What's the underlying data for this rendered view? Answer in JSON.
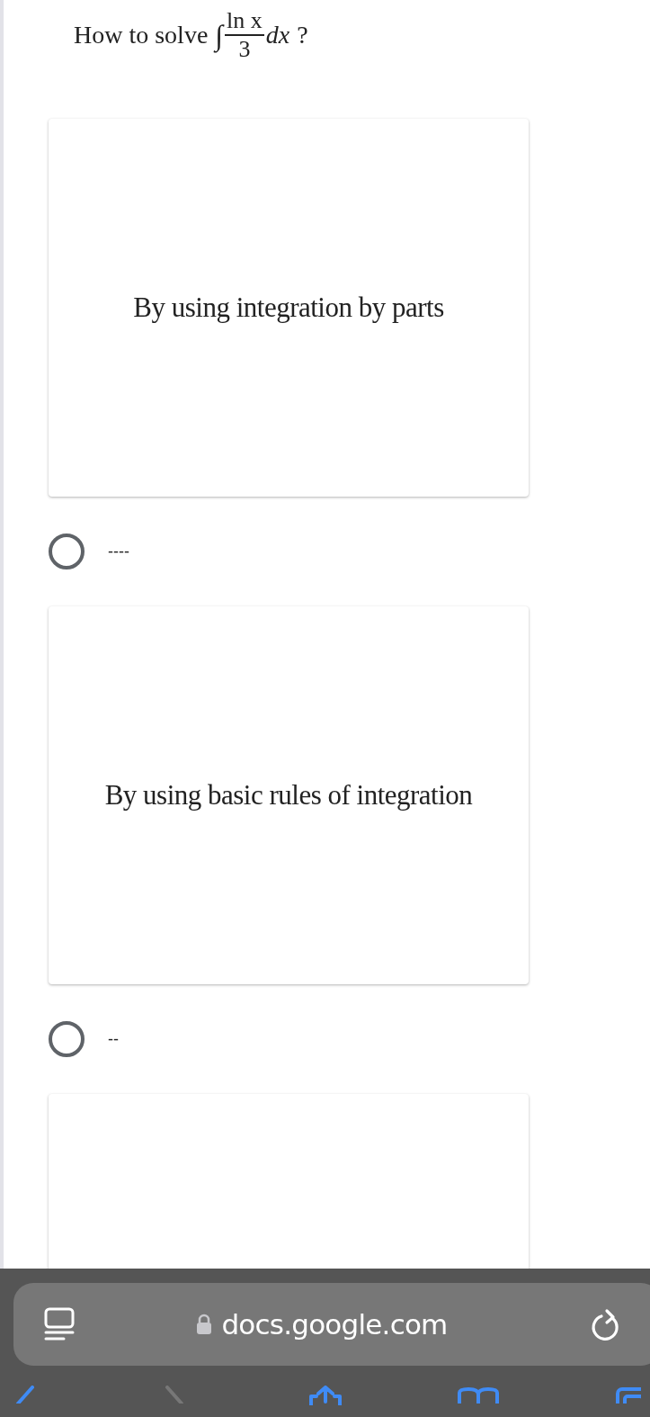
{
  "question": {
    "prefix": "How to solve",
    "integral_sign": "∫",
    "numerator": "ln x",
    "denominator": "3",
    "differential": "dx",
    "suffix": "?"
  },
  "options": [
    {
      "kind": "card",
      "image_text": "By using integration by parts",
      "label": "----",
      "selected": false
    },
    {
      "kind": "card",
      "image_text": "By using basic rules of integration",
      "label": "--",
      "selected": false
    },
    {
      "kind": "card_only"
    }
  ],
  "browser": {
    "url": "docs.google.com",
    "secure": true,
    "forward_enabled": false
  }
}
